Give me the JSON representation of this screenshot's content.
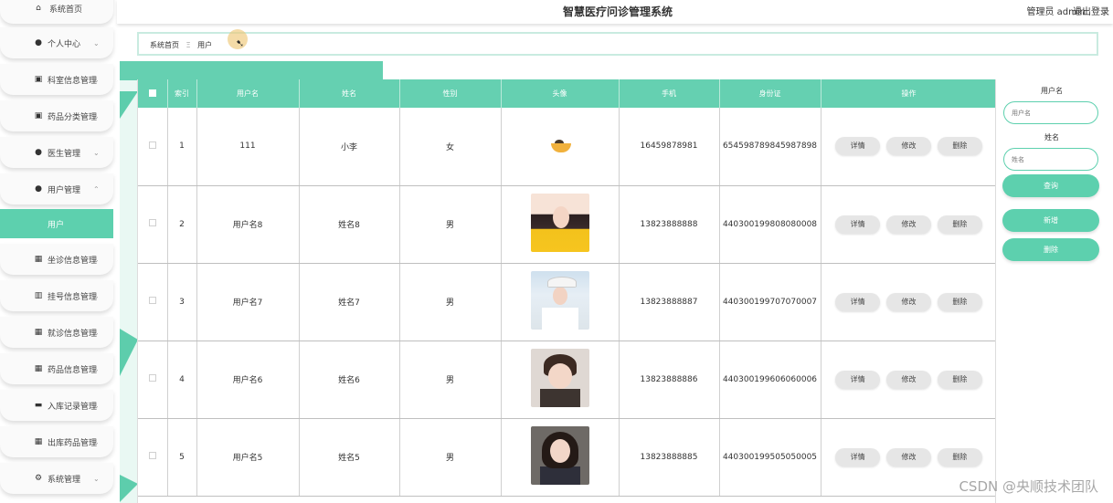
{
  "app": {
    "title": "智慧医疗问诊管理系统"
  },
  "header": {
    "user_label": "管理员 admin",
    "logout_label": "退出登录"
  },
  "sidebar": {
    "items": [
      {
        "label": "系统首页",
        "icon": "home-icon"
      },
      {
        "label": "个人中心",
        "icon": "person-icon"
      },
      {
        "label": "科室信息管理",
        "icon": "clipboard-icon"
      },
      {
        "label": "药品分类管理",
        "icon": "clipboard-icon"
      },
      {
        "label": "医生管理",
        "icon": "person-icon"
      },
      {
        "label": "用户管理",
        "icon": "person-icon"
      },
      {
        "label": "坐诊信息管理",
        "icon": "grid-icon"
      },
      {
        "label": "挂号信息管理",
        "icon": "bar-chart-icon"
      },
      {
        "label": "就诊信息管理",
        "icon": "grid-icon"
      },
      {
        "label": "药品信息管理",
        "icon": "grid-icon"
      },
      {
        "label": "入库记录管理",
        "icon": "monitor-icon"
      },
      {
        "label": "出库药品管理",
        "icon": "grid-icon"
      },
      {
        "label": "系统管理",
        "icon": "gear-icon"
      }
    ],
    "active_sub": "用户"
  },
  "breadcrumb": {
    "home": "系统首页",
    "separator": "Ξ",
    "current": "用户"
  },
  "table": {
    "columns": [
      "",
      "索引",
      "用户名",
      "姓名",
      "性别",
      "头像",
      "手机",
      "身份证",
      "操作"
    ],
    "rows": [
      {
        "index": "1",
        "username": "111",
        "name": "小李",
        "gender": "女",
        "avatar": "food-bowl",
        "phone": "16459878981",
        "id_card": "654598789845987898"
      },
      {
        "index": "2",
        "username": "用户名8",
        "name": "姓名8",
        "gender": "男",
        "avatar": "woman-yellow",
        "phone": "13823888888",
        "id_card": "440300199808080008"
      },
      {
        "index": "3",
        "username": "用户名7",
        "name": "姓名7",
        "gender": "男",
        "avatar": "woman-cap",
        "phone": "13823888887",
        "id_card": "440300199707070007"
      },
      {
        "index": "4",
        "username": "用户名6",
        "name": "姓名6",
        "gender": "男",
        "avatar": "young-man",
        "phone": "13823888886",
        "id_card": "440300199606060006"
      },
      {
        "index": "5",
        "username": "用户名5",
        "name": "姓名5",
        "gender": "男",
        "avatar": "woman-dark-hair",
        "phone": "13823888885",
        "id_card": "440300199505050005"
      }
    ],
    "actions": {
      "detail": "详情",
      "edit": "修改",
      "delete": "删除"
    }
  },
  "search": {
    "username_label": "用户名",
    "username_placeholder": "用户名",
    "name_label": "姓名",
    "name_placeholder": "姓名",
    "search_button": "查询",
    "add_button": "新增",
    "delete_button": "删除"
  },
  "watermark": "CSDN @央顺技术团队",
  "colors": {
    "accent": "#5dd0ae",
    "header_row": "#65d0b1"
  }
}
